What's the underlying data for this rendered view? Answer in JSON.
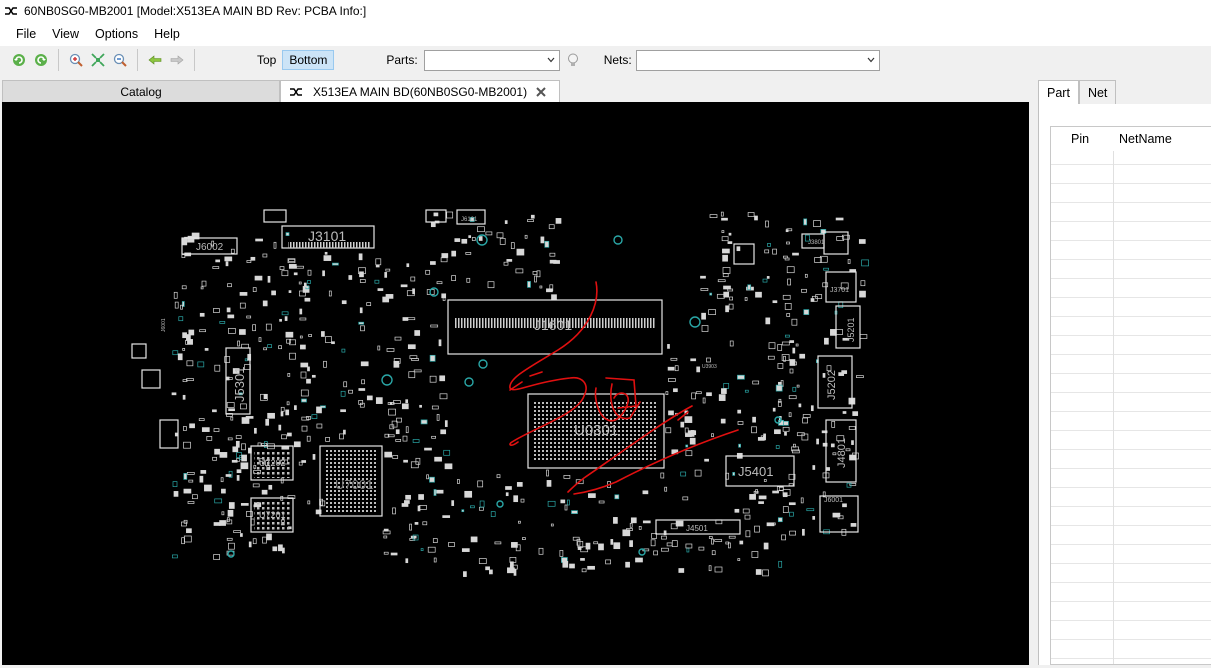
{
  "window": {
    "title": "60NB0SG0-MB2001 [Model:X513EA MAIN BD Rev: PCBA Info:]"
  },
  "menu": {
    "items": [
      "File",
      "View",
      "Options",
      "Help"
    ]
  },
  "toolbar": {
    "side_top": "Top",
    "side_bottom": "Bottom",
    "side_active": "Bottom",
    "parts_label": "Parts:",
    "parts_value": "",
    "nets_label": "Nets:",
    "nets_value": ""
  },
  "tabs": {
    "catalog": "Catalog",
    "board": "X513EA MAIN BD(60NB0SG0-MB2001)"
  },
  "board": {
    "background": "#000000",
    "outline_color": "#e6e6e6",
    "accent_color": "#2aa7a7",
    "annotation_color": "#e01010",
    "labels": {
      "j3101": "J3101",
      "j6002": "J6002",
      "j6101": "J6101",
      "j1601": "J1601",
      "j5301": "J5301",
      "u0301": "U0301",
      "u7202": "U7202",
      "u7201": "U7201",
      "u7001": "U7001",
      "j5401": "J5401",
      "j4501": "J4501",
      "j3701": "J3701",
      "j5201": "J5201",
      "j5202": "J5202",
      "j4801": "J4801",
      "j6001": "J6001",
      "j3801": "J3801",
      "j6001b": "J6001",
      "u3903": "U3903"
    }
  },
  "right_panel": {
    "tab_part": "Part",
    "tab_net": "Net",
    "col_pin": "Pin",
    "col_netname": "NetName"
  }
}
